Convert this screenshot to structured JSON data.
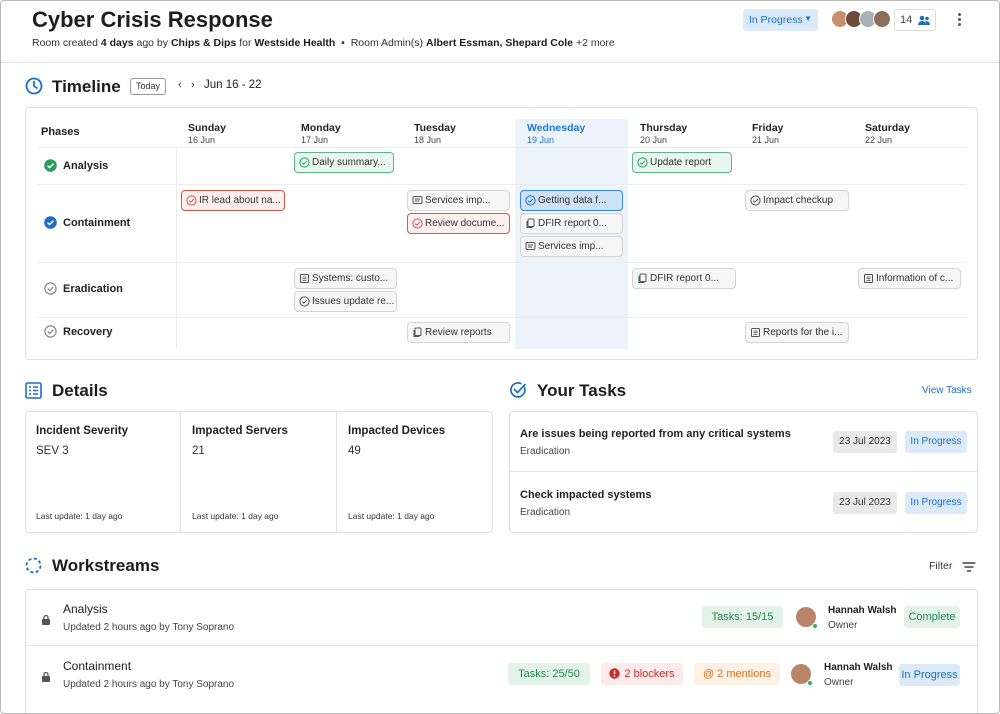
{
  "header": {
    "title": "Cyber Crisis Response",
    "sub_created": "Room created",
    "sub_age": "4 days",
    "sub_ago_by": "ago by",
    "sub_org": "Chips & Dips",
    "sub_for": "for",
    "sub_client": "Westside Health",
    "sub_sep": "•",
    "sub_admins_label": "Room Admin(s)",
    "sub_admins": "Albert Essman, Shepard Cole",
    "sub_more": "+2 more",
    "status": "In Progress",
    "member_count": "14"
  },
  "timeline": {
    "title": "Timeline",
    "today": "Today",
    "prev": "‹",
    "next": "›",
    "range": "Jun 16 - 22",
    "phases_label": "Phases",
    "days": [
      {
        "name": "Sunday",
        "date": "16 Jun"
      },
      {
        "name": "Monday",
        "date": "17 Jun"
      },
      {
        "name": "Tuesday",
        "date": "18 Jun"
      },
      {
        "name": "Wednesday",
        "date": "19 Jun"
      },
      {
        "name": "Thursday",
        "date": "20 Jun"
      },
      {
        "name": "Friday",
        "date": "21 Jun"
      },
      {
        "name": "Saturday",
        "date": "22 Jun"
      }
    ],
    "phases": [
      {
        "name": "Analysis"
      },
      {
        "name": "Containment"
      },
      {
        "name": "Eradication"
      },
      {
        "name": "Recovery"
      }
    ],
    "events": [
      {
        "text": "Daily summary..."
      },
      {
        "text": "Update report"
      },
      {
        "text": "IR lead about na..."
      },
      {
        "text": "Services imp..."
      },
      {
        "text": "Review docume..."
      },
      {
        "text": "Getting data f..."
      },
      {
        "text": "DFIR report 0..."
      },
      {
        "text": "Services imp..."
      },
      {
        "text": "Impact checkup"
      },
      {
        "text": "Systems: custo..."
      },
      {
        "text": "Issues update re..."
      },
      {
        "text": "DFIR report 0..."
      },
      {
        "text": "Information of c..."
      },
      {
        "text": "Review reports"
      },
      {
        "text": "Reports for the i..."
      }
    ]
  },
  "details": {
    "title": "Details",
    "cells": [
      {
        "label": "Incident Severity",
        "value": "SEV 3",
        "updated": "Last update: 1 day ago"
      },
      {
        "label": "Impacted Servers",
        "value": "21",
        "updated": "Last update: 1 day ago"
      },
      {
        "label": "Impacted Devices",
        "value": "49",
        "updated": "Last update: 1 day ago"
      }
    ]
  },
  "tasks": {
    "title": "Your Tasks",
    "view_all": "View Tasks",
    "items": [
      {
        "title": "Are issues being reported from any critical systems",
        "phase": "Eradication",
        "date": "23 Jul 2023",
        "status": "In Progress"
      },
      {
        "title": "Check impacted systems",
        "phase": "Eradication",
        "date": "23 Jul 2023",
        "status": "In Progress"
      }
    ]
  },
  "workstreams": {
    "title": "Workstreams",
    "filter": "Filter",
    "items": [
      {
        "name": "Analysis",
        "updated": "Updated 2 hours ago by Tony Soprano",
        "tasks": "Tasks: 15/15",
        "owner": "Hannah Walsh",
        "role": "Owner",
        "status": "Complete"
      },
      {
        "name": "Containment",
        "updated": "Updated 2 hours ago by Tony Soprano",
        "tasks": "Tasks: 25/50",
        "blockers": "2 blockers",
        "mentions": "2 mentions",
        "owner": "Hannah Walsh",
        "role": "Owner",
        "status": "In Progress"
      }
    ]
  },
  "colors": {
    "accent": "#1c6fc7",
    "success": "#258a51",
    "danger": "#c62f2a",
    "warning": "#d8731f"
  }
}
